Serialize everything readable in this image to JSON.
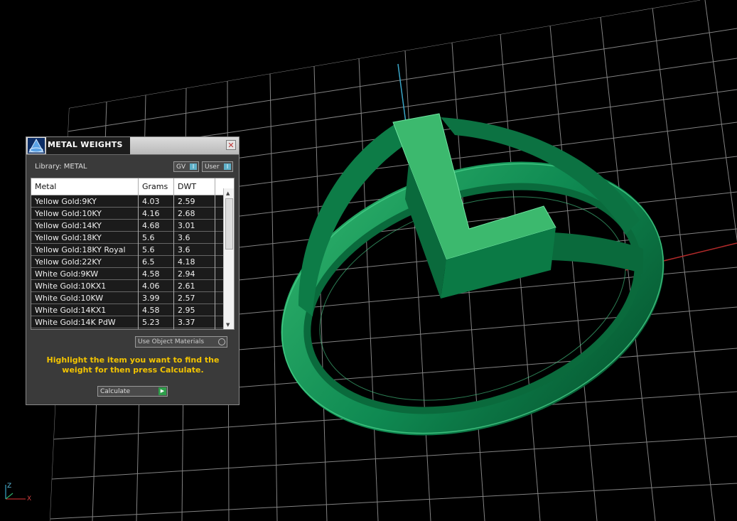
{
  "panel": {
    "title": "METAL WEIGHTS",
    "close_glyph": "✕",
    "library_label": "Library: METAL",
    "gv_label": "GV",
    "user_label": "User",
    "indicator_glyph": "I",
    "columns": [
      "Metal",
      "Grams",
      "DWT"
    ],
    "rows": [
      {
        "metal": "Yellow Gold:9KY",
        "grams": "4.03",
        "dwt": "2.59"
      },
      {
        "metal": "Yellow Gold:10KY",
        "grams": "4.16",
        "dwt": "2.68"
      },
      {
        "metal": "Yellow Gold:14KY",
        "grams": "4.68",
        "dwt": "3.01"
      },
      {
        "metal": "Yellow Gold:18KY",
        "grams": "5.6",
        "dwt": "3.6"
      },
      {
        "metal": "Yellow Gold:18KY Royal",
        "grams": "5.6",
        "dwt": "3.6"
      },
      {
        "metal": "Yellow Gold:22KY",
        "grams": "6.5",
        "dwt": "4.18"
      },
      {
        "metal": "White Gold:9KW",
        "grams": "4.58",
        "dwt": "2.94"
      },
      {
        "metal": "White Gold:10KX1",
        "grams": "4.06",
        "dwt": "2.61"
      },
      {
        "metal": "White Gold:10KW",
        "grams": "3.99",
        "dwt": "2.57"
      },
      {
        "metal": "White Gold:14KX1",
        "grams": "4.58",
        "dwt": "2.95"
      },
      {
        "metal": "White Gold:14K PdW",
        "grams": "5.23",
        "dwt": "3.37"
      }
    ],
    "use_object_materials_label": "Use Object Materials",
    "hint": "Highlight the item you want to find the weight for then press Calculate.",
    "calculate_label": "Calculate"
  },
  "viewport": {
    "axis_labels": {
      "z": "Z",
      "x": "X"
    },
    "colors": {
      "ring": "#0f8a52",
      "ring_light": "#3fc07a",
      "grid": "#a0a0a0",
      "x_axis": "#b22a2a",
      "y_axis": "#3aa6c8"
    }
  }
}
